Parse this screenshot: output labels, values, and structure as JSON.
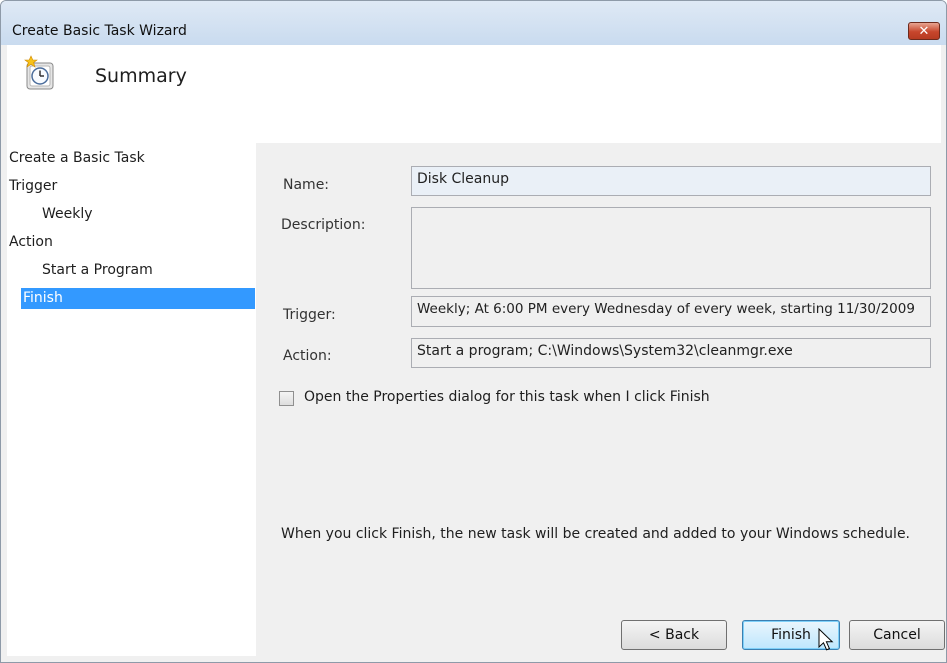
{
  "window": {
    "title": "Create Basic Task Wizard",
    "close_label": "✕"
  },
  "header": {
    "title": "Summary",
    "icon": "task-clock-icon"
  },
  "sidebar": {
    "items": [
      {
        "label": "Create a Basic Task"
      },
      {
        "label": "Trigger"
      },
      {
        "label": "Weekly"
      },
      {
        "label": "Action"
      },
      {
        "label": "Start a Program"
      },
      {
        "label": "Finish",
        "selected": true
      }
    ]
  },
  "form": {
    "name_label": "Name:",
    "name_value": "Disk Cleanup",
    "description_label": "Description:",
    "description_value": "",
    "trigger_label": "Trigger:",
    "trigger_value": "Weekly; At 6:00 PM every Wednesday of every week, starting 11/30/2009",
    "action_label": "Action:",
    "action_value": "Start a program; C:\\Windows\\System32\\cleanmgr.exe",
    "open_properties_label": "Open the Properties dialog for this task when I click Finish",
    "open_properties_checked": false,
    "info": "When you click Finish, the new task will be created and added to your Windows schedule."
  },
  "buttons": {
    "back": "< Back",
    "finish": "Finish",
    "cancel": "Cancel"
  },
  "colors": {
    "selection": "#3399ff",
    "titlebar": "#c9dbef",
    "close": "#c7462c"
  }
}
